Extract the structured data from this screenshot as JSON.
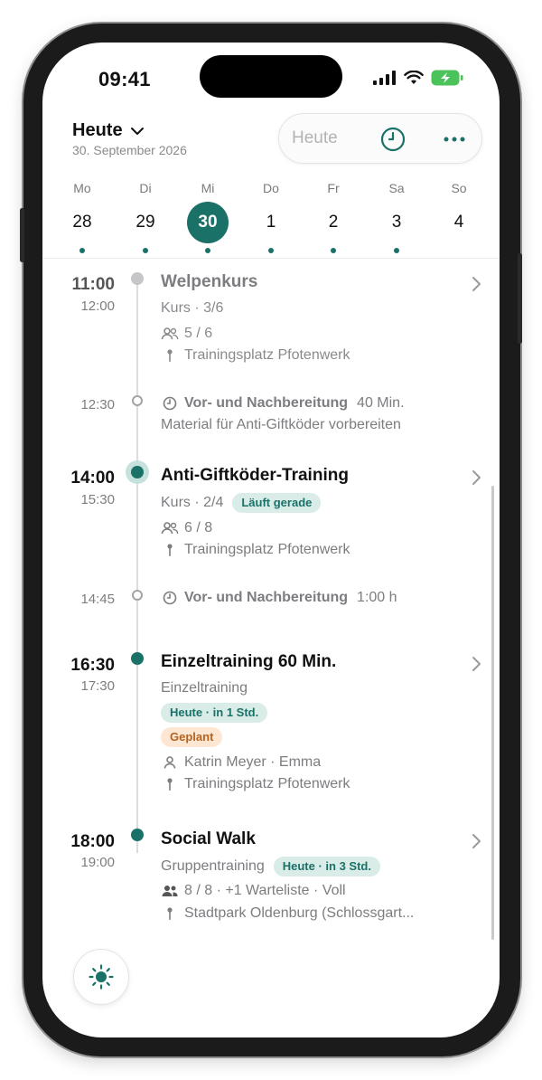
{
  "status_bar": {
    "time": "09:41"
  },
  "header": {
    "title": "Heute",
    "date": "30. September 2026",
    "pill_label": "Heute"
  },
  "week": [
    {
      "name": "Mo",
      "num": "28",
      "dot": true,
      "selected": false
    },
    {
      "name": "Di",
      "num": "29",
      "dot": true,
      "selected": false
    },
    {
      "name": "Mi",
      "num": "30",
      "dot": true,
      "selected": true
    },
    {
      "name": "Do",
      "num": "1",
      "dot": true,
      "selected": false
    },
    {
      "name": "Fr",
      "num": "2",
      "dot": true,
      "selected": false
    },
    {
      "name": "Sa",
      "num": "3",
      "dot": true,
      "selected": false
    },
    {
      "name": "So",
      "num": "4",
      "dot": false,
      "selected": false
    }
  ],
  "events": {
    "welpenkurs": {
      "start": "11:00",
      "end": "12:00",
      "title": "Welpenkurs",
      "subtitle": "Kurs · 3/6",
      "participants": "5 / 6",
      "location": "Trainingsplatz Pfotenwerk"
    },
    "prep1": {
      "time": "12:30",
      "label": "Vor- und Nachbereitung",
      "duration": "40 Min.",
      "note": "Material für Anti-Giftköder vorbereiten"
    },
    "antigift": {
      "start": "14:00",
      "end": "15:30",
      "title": "Anti-Giftköder-Training",
      "subtitle": "Kurs · 2/4",
      "badge": "Läuft gerade",
      "participants": "6 / 8",
      "location": "Trainingsplatz Pfotenwerk"
    },
    "prep2": {
      "time": "14:45",
      "label": "Vor- und Nachbereitung",
      "duration": "1:00 h"
    },
    "einzel": {
      "start": "16:30",
      "end": "17:30",
      "title": "Einzeltraining 60 Min.",
      "subtitle": "Einzeltraining",
      "badge_today": "Heute · in 1 Std.",
      "badge_status": "Geplant",
      "client": "Katrin Meyer · Emma",
      "location": "Trainingsplatz Pfotenwerk"
    },
    "social": {
      "start": "18:00",
      "end": "19:00",
      "title": "Social Walk",
      "subtitle": "Gruppentraining",
      "badge": "Heute · in 3 Std.",
      "participants": "8 / 8 · +1 Warteliste · Voll",
      "location": "Stadtpark Oldenburg (Schlossgart..."
    }
  },
  "colors": {
    "accent": "#1a7168",
    "accent_light": "#d9ece8",
    "warning_light": "#fde7d3",
    "warning_text": "#b4621f"
  },
  "icons": {
    "header_chevron": "chevron-down-icon",
    "pill_clock": "clock-icon",
    "pill_more": "more-dots-icon",
    "participants": "people-icon",
    "location": "location-pin-icon",
    "prep": "clock-icon",
    "client": "person-icon",
    "theme_toggle": "sun-icon"
  }
}
